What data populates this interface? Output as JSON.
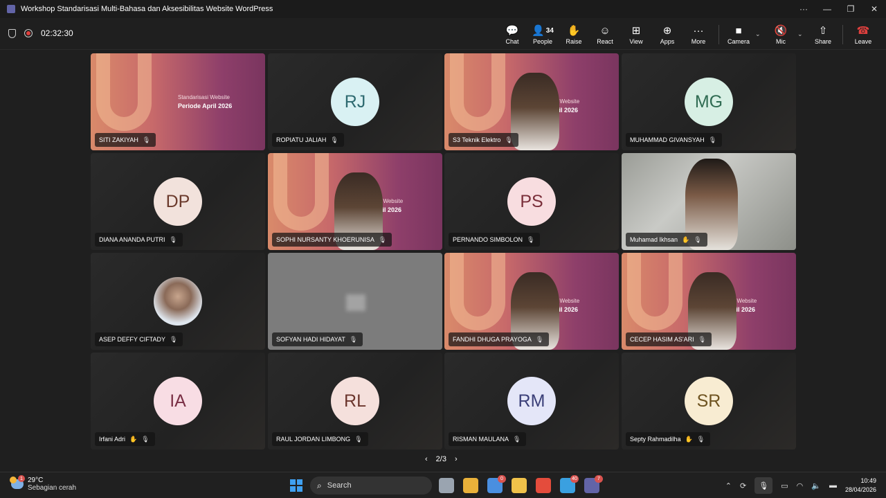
{
  "window": {
    "title": "Workshop Standarisasi Multi-Bahasa dan Aksesibilitas Website WordPress",
    "controls": [
      "···",
      "—",
      "❐",
      "✕"
    ]
  },
  "meeting": {
    "timer": "02:32:30",
    "toolbar": [
      {
        "label": "Chat",
        "icon": "chat-icon"
      },
      {
        "label": "People",
        "icon": "people-icon",
        "count": "34"
      },
      {
        "label": "Raise",
        "icon": "hand-icon"
      },
      {
        "label": "React",
        "icon": "smile-icon"
      },
      {
        "label": "View",
        "icon": "grid-icon"
      },
      {
        "label": "Apps",
        "icon": "plus-square-icon"
      },
      {
        "label": "More",
        "icon": "more-icon"
      },
      {
        "label": "Camera",
        "icon": "camera-icon"
      },
      {
        "label": "Mic",
        "icon": "mic-muted-icon"
      },
      {
        "label": "Share",
        "icon": "share-icon"
      },
      {
        "label": "Leave",
        "icon": "phone-hangup-icon"
      }
    ]
  },
  "slide": {
    "line1": "Standarisasi Website",
    "line2": "Periode April 2026",
    "line1_partial": "sasi Website",
    "line2_partial": "April 2026"
  },
  "participants": [
    {
      "name": "SITI ZAKIYAH",
      "kind": "slide",
      "hand": false
    },
    {
      "name": "ROPIATU JALIAH",
      "kind": "avatar",
      "initials": "RJ",
      "bg": "#d9f1f3",
      "fg": "#2e6a70",
      "hand": false
    },
    {
      "name": "S3 Teknik Elektro",
      "kind": "slide-video",
      "hand": false
    },
    {
      "name": "MUHAMMAD GIVANSYAH",
      "kind": "avatar",
      "initials": "MG",
      "bg": "#d7efe4",
      "fg": "#2f6b52",
      "hand": false
    },
    {
      "name": "DIANA ANANDA PUTRI",
      "kind": "avatar",
      "initials": "DP",
      "bg": "#f2e2dc",
      "fg": "#6b3a2c",
      "hand": false
    },
    {
      "name": "SOPHI NURSANTY KHOERUNISA",
      "kind": "slide-video",
      "hand": false
    },
    {
      "name": "PERNANDO SIMBOLON",
      "kind": "avatar",
      "initials": "PS",
      "bg": "#f8dde0",
      "fg": "#7a2f3a",
      "hand": false
    },
    {
      "name": "Muhamad Ikhsan",
      "kind": "room",
      "hand": true
    },
    {
      "name": "ASEP DEFFY CIFTADY",
      "kind": "photo",
      "hand": false
    },
    {
      "name": "SOFYAN HADI HIDAYAT",
      "kind": "gray",
      "hand": false
    },
    {
      "name": "FANDHI DHUGA PRAYOGA",
      "kind": "slide-video",
      "hand": false
    },
    {
      "name": "CECEP HASIM AS'ARI",
      "kind": "slide-video",
      "hand": false
    },
    {
      "name": "Irfani Adri",
      "kind": "avatar",
      "initials": "IA",
      "bg": "#f8dde4",
      "fg": "#7a2f45",
      "hand": true
    },
    {
      "name": "RAUL JORDAN LIMBONG",
      "kind": "avatar",
      "initials": "RL",
      "bg": "#f5e0dc",
      "fg": "#6b352c",
      "hand": false
    },
    {
      "name": "RISMAN MAULANA",
      "kind": "avatar",
      "initials": "RM",
      "bg": "#e4e6f8",
      "fg": "#3b3f78",
      "hand": false
    },
    {
      "name": "Septy Rahmadilha",
      "kind": "avatar",
      "initials": "SR",
      "bg": "#f8ecd2",
      "fg": "#6e5320",
      "hand": true
    }
  ],
  "pager": {
    "label": "2/3",
    "prev": "‹",
    "next": "›"
  },
  "taskbar": {
    "weather_temp": "29°C",
    "weather_desc": "Sebagian cerah",
    "weather_badge": "1",
    "search_label": "Search",
    "apps": [
      {
        "name": "file-manager-icon",
        "color": "#9aa4b0",
        "count": ""
      },
      {
        "name": "chrome-icon",
        "color": "#e9b13a",
        "count": ""
      },
      {
        "name": "chrome-profile-icon",
        "color": "#4a8fe0",
        "count": "0"
      },
      {
        "name": "folder-icon",
        "color": "#f0c24a",
        "count": ""
      },
      {
        "name": "chrome-icon-2",
        "color": "#e44c3c",
        "count": ""
      },
      {
        "name": "telegram-icon",
        "color": "#3aa0e0",
        "count": "40"
      },
      {
        "name": "teams-icon",
        "color": "#6264a7",
        "count": "7"
      }
    ],
    "time": "10:49",
    "date": "28/04/2026"
  }
}
